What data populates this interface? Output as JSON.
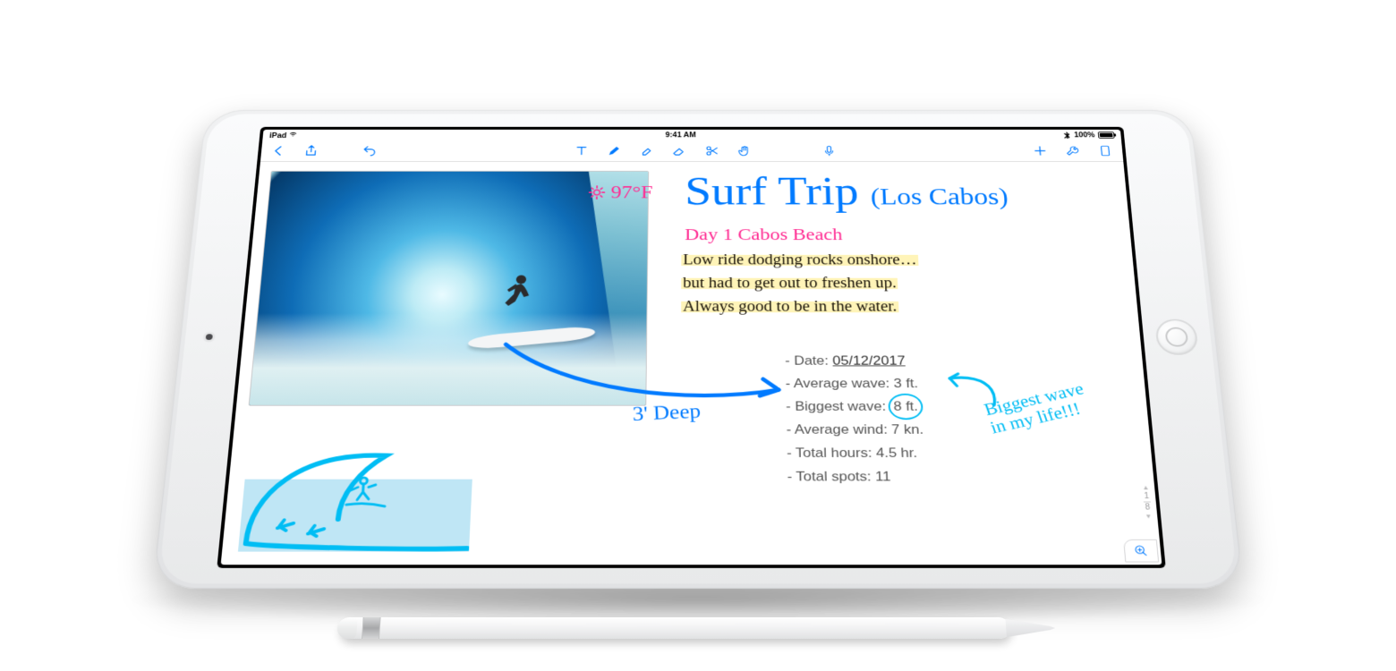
{
  "status": {
    "device": "iPad",
    "time": "9:41 AM",
    "battery": "100%"
  },
  "toolbar": {
    "back": "Back",
    "share": "Share",
    "undo": "Undo",
    "text": "Text tool",
    "pen": "Pen",
    "highlighter": "Highlighter",
    "eraser": "Eraser",
    "scissors": "Lasso",
    "pointer": "Hand",
    "mic": "Dictate",
    "add": "Add",
    "wrench": "Tools",
    "pages": "Pages"
  },
  "note": {
    "photo_temp": "97°F",
    "title_main": "Surf Trip",
    "title_loc": "(Los Cabos)",
    "day_label": "Day 1 Cabos Beach",
    "paragraph": [
      "Low ride dodging rocks onshore…",
      "but had to get out to freshen up.",
      "Always good to be in the water."
    ],
    "depth_label": "3' Deep",
    "biggest_label": "Biggest wave\nin my life!!!",
    "stats": {
      "date_label": "Date:",
      "date_value": "05/12/2017",
      "avg_wave_label": "Average wave:",
      "avg_wave_value": "3 ft.",
      "big_wave_label": "Biggest wave:",
      "big_wave_value": "8 ft.",
      "avg_wind_label": "Average wind:",
      "avg_wind_value": "7 kn.",
      "hours_label": "Total hours:",
      "hours_value": "4.5 hr.",
      "spots_label": "Total spots:",
      "spots_value": "11"
    }
  },
  "pager": {
    "page": "1",
    "total": "8"
  }
}
